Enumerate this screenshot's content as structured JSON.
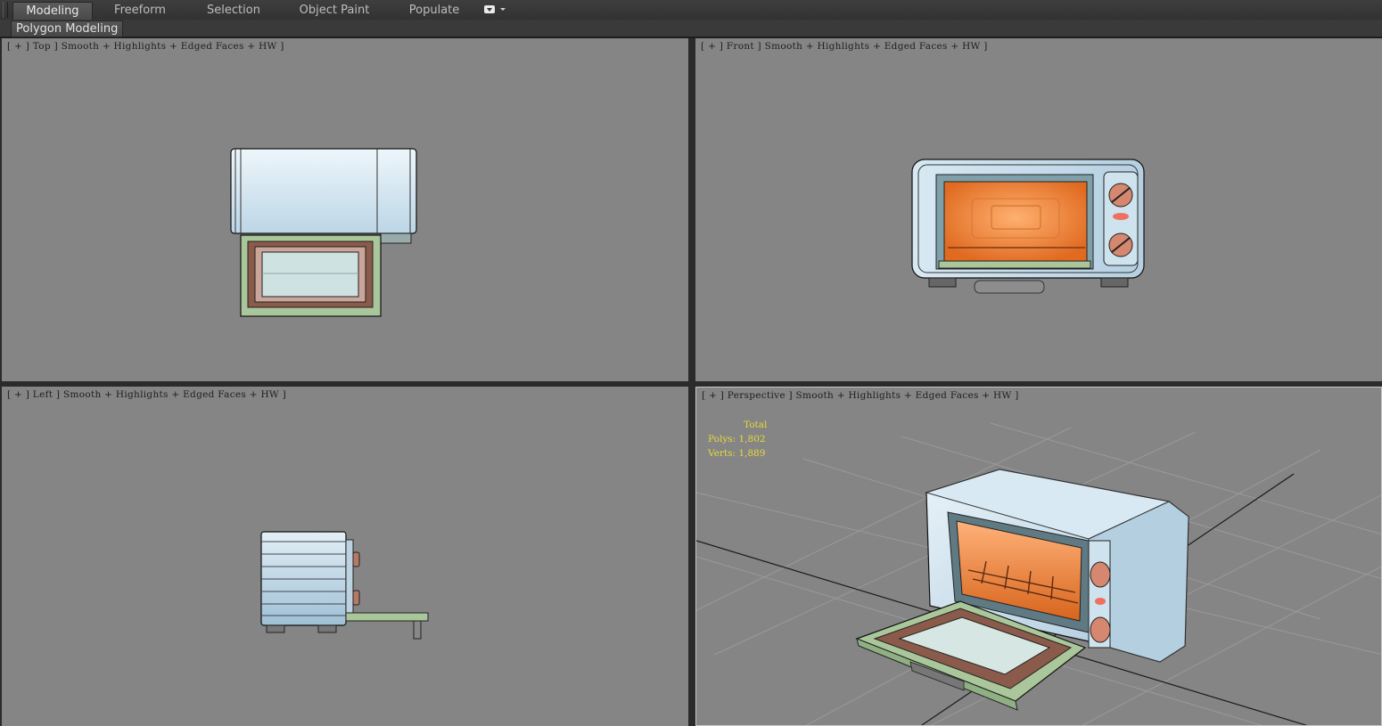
{
  "ribbon": {
    "tabs": [
      "Modeling",
      "Freeform",
      "Selection",
      "Object Paint",
      "Populate"
    ],
    "active_tab": "Modeling",
    "panel_label": "Polygon Modeling"
  },
  "viewports": {
    "top": {
      "label": "[ + ] Top ] Smooth + Highlights + Edged Faces + HW ]"
    },
    "front": {
      "label": "[ + ] Front ] Smooth + Highlights + Edged Faces + HW ]"
    },
    "left": {
      "label": "[ + ] Left ] Smooth + Highlights + Edged Faces + HW ]"
    },
    "perspective": {
      "label": "[ + ] Perspective ] Smooth + Highlights + Edged Faces + HW ]",
      "stats": {
        "title": "Total",
        "polys": "Polys: 1,802",
        "verts": "Verts: 1,889"
      }
    }
  },
  "colors": {
    "viewport_bg": "#858585",
    "body_blue": "#bcd6e6",
    "interior_orange": "#f08a3a",
    "door_green": "#a9c79a",
    "door_brown": "#8a5a4a",
    "stats_text": "#e6d83c"
  },
  "icons": [
    "viewport-dropdown-icon",
    "chevron-down-icon"
  ]
}
